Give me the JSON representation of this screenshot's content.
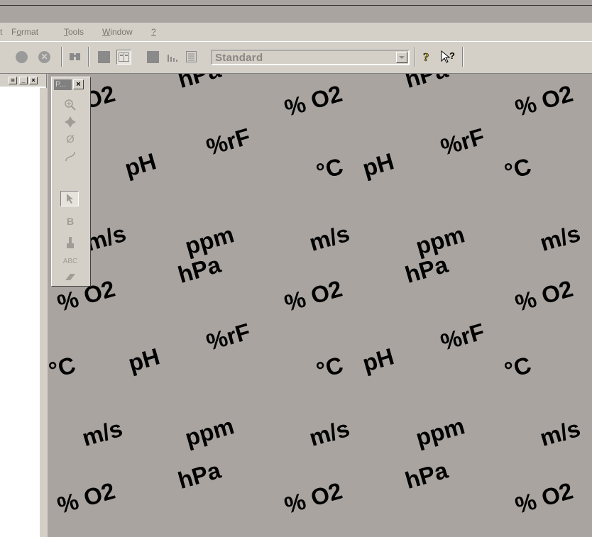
{
  "menu": {
    "items": [
      {
        "label": "t",
        "underline": ""
      },
      {
        "label": "Format",
        "underline": "o"
      },
      {
        "label": "Tools",
        "underline": "T"
      },
      {
        "label": "Window",
        "underline": "W"
      },
      {
        "label": "?",
        "underline": "?"
      }
    ]
  },
  "toolbar": {
    "style_combo_value": "Standard",
    "icons": [
      "record-icon",
      "cancel-icon",
      "find-icon",
      "page-icon",
      "split-view-icon",
      "block-icon",
      "chart-icon",
      "form-icon",
      "help-icon",
      "context-help-icon"
    ]
  },
  "palette": {
    "title": "P...",
    "close_label": "×",
    "tools": [
      "zoom-icon",
      "pan-icon",
      "diameter-icon",
      "curve-icon",
      "pointer-icon",
      "bold-b-icon",
      "brush-icon",
      "text-abc-icon",
      "eraser-icon"
    ],
    "text_tool_label": "ABC"
  },
  "left_pane": {
    "minimize_label": "_",
    "close_label": "×"
  },
  "background_units": [
    "% O2",
    "hPa",
    "pH",
    "%rF",
    "°C",
    "m/s",
    "ppm"
  ],
  "colors": {
    "canvas": "#a9a4a0",
    "chrome": "#d4d0c8",
    "disabled_text": "#8a8680"
  }
}
